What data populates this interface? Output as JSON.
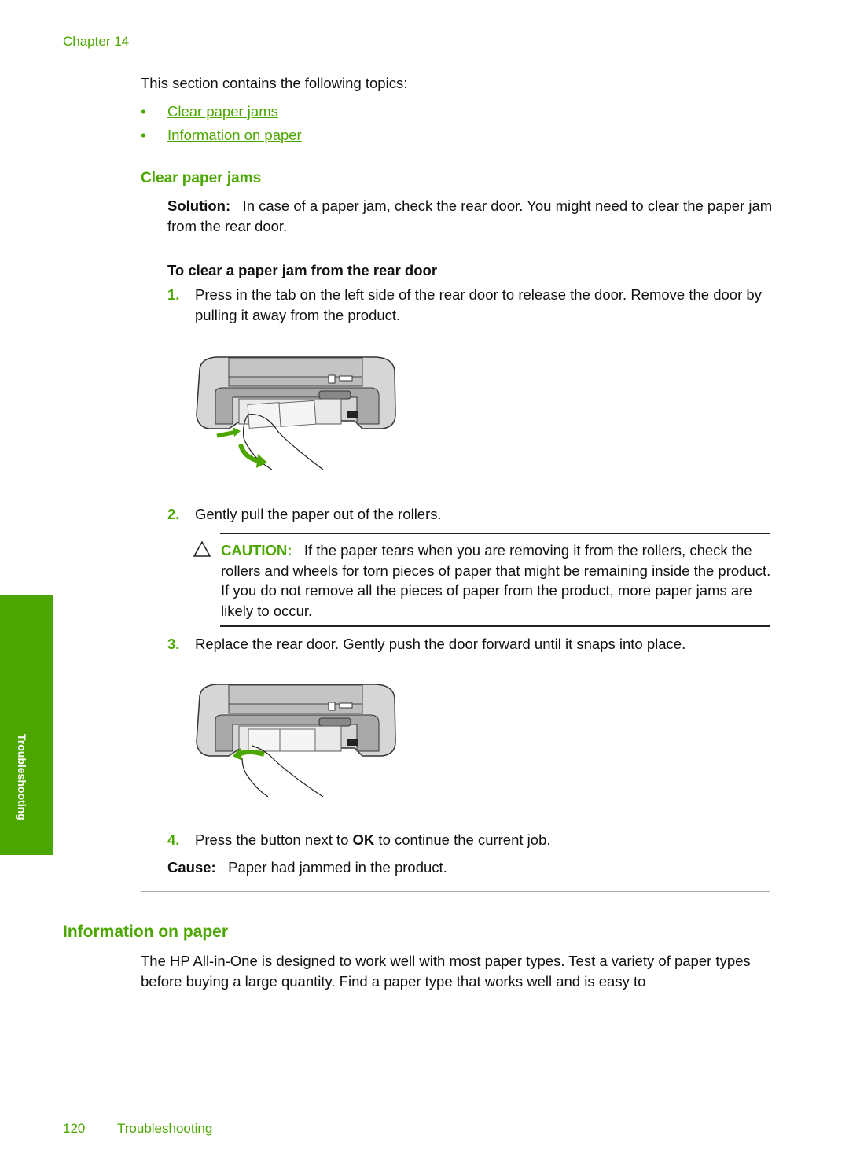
{
  "header": {
    "chapter": "Chapter 14"
  },
  "intro": "This section contains the following topics:",
  "toc": [
    {
      "bullet": "•",
      "label": "Clear paper jams"
    },
    {
      "bullet": "•",
      "label": "Information on paper"
    }
  ],
  "clear_jams": {
    "heading": "Clear paper jams",
    "solution_label": "Solution:",
    "solution_text": "In case of a paper jam, check the rear door. You might need to clear the paper jam from the rear door.",
    "procedure_title": "To clear a paper jam from the rear door",
    "steps": [
      {
        "num": "1.",
        "text": "Press in the tab on the left side of the rear door to release the door. Remove the door by pulling it away from the product."
      },
      {
        "num": "2.",
        "text": "Gently pull the paper out of the rollers."
      },
      {
        "num": "3.",
        "text": "Replace the rear door. Gently push the door forward until it snaps into place."
      },
      {
        "num": "4.",
        "text_before": "Press the button next to ",
        "text_bold": "OK",
        "text_after": " to continue the current job."
      }
    ],
    "caution": {
      "label": "CAUTION:",
      "text": "If the paper tears when you are removing it from the rollers, check the rollers and wheels for torn pieces of paper that might be remaining inside the product. If you do not remove all the pieces of paper from the product, more paper jams are likely to occur."
    },
    "cause_label": "Cause:",
    "cause_text": "Paper had jammed in the product.",
    "figures": [
      {
        "caption": "printer-rear-door-removal-illustration"
      },
      {
        "caption": "printer-rear-door-replace-illustration"
      }
    ]
  },
  "paper_info": {
    "heading": "Information on paper",
    "text": "The HP All-in-One is designed to work well with most paper types. Test a variety of paper types before buying a large quantity. Find a paper type that works well and is easy to"
  },
  "side_tab": {
    "label": "Troubleshooting"
  },
  "footer": {
    "page_number": "120",
    "section": "Troubleshooting"
  },
  "colors": {
    "accent": "#4ba700",
    "text": "#111111"
  }
}
